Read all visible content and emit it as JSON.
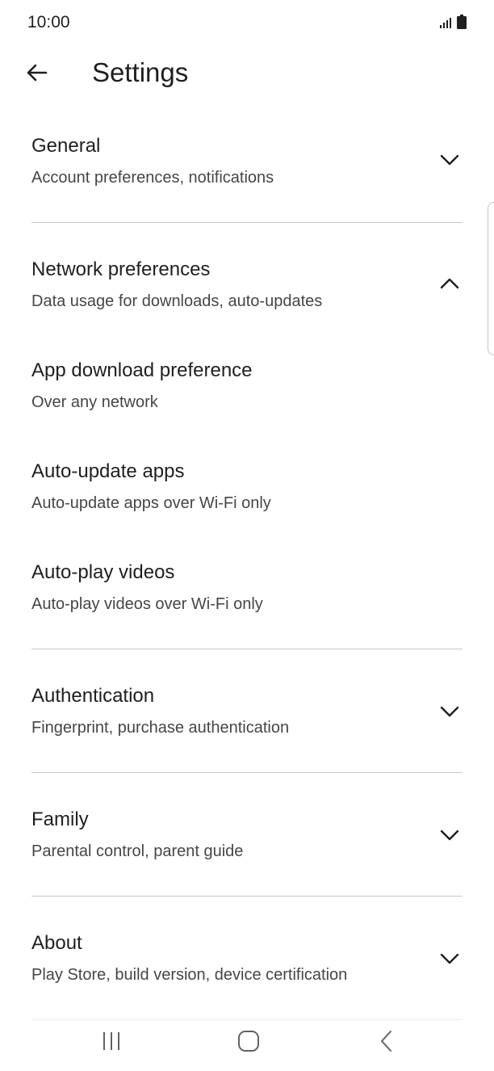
{
  "status_bar": {
    "time": "10:00",
    "signal_icon": "signal-icon",
    "battery_icon": "battery-icon"
  },
  "app_bar": {
    "back_icon": "arrow-back-icon",
    "title": "Settings"
  },
  "sections": [
    {
      "title": "General",
      "subtitle": "Account preferences, notifications",
      "chevron": "chevron-down-icon",
      "expanded": false
    },
    {
      "title": "Network preferences",
      "subtitle": "Data usage for downloads, auto-updates",
      "chevron": "chevron-up-icon",
      "expanded": true,
      "items": [
        {
          "title": "App download preference",
          "subtitle": "Over any network"
        },
        {
          "title": "Auto-update apps",
          "subtitle": "Auto-update apps over Wi-Fi only"
        },
        {
          "title": "Auto-play videos",
          "subtitle": "Auto-play videos over Wi-Fi only"
        }
      ]
    },
    {
      "title": "Authentication",
      "subtitle": "Fingerprint, purchase authentication",
      "chevron": "chevron-down-icon",
      "expanded": false
    },
    {
      "title": "Family",
      "subtitle": "Parental control, parent guide",
      "chevron": "chevron-down-icon",
      "expanded": false
    },
    {
      "title": "About",
      "subtitle": "Play Store, build version, device certification",
      "chevron": "chevron-down-icon",
      "expanded": false
    }
  ],
  "nav_bar": {
    "recents_icon": "recents-icon",
    "home_icon": "home-icon",
    "back_icon": "nav-back-icon"
  },
  "colors": {
    "text_primary": "#1f1f1f",
    "text_secondary": "#444746",
    "divider": "#c7c7c7",
    "background": "#ffffff"
  }
}
